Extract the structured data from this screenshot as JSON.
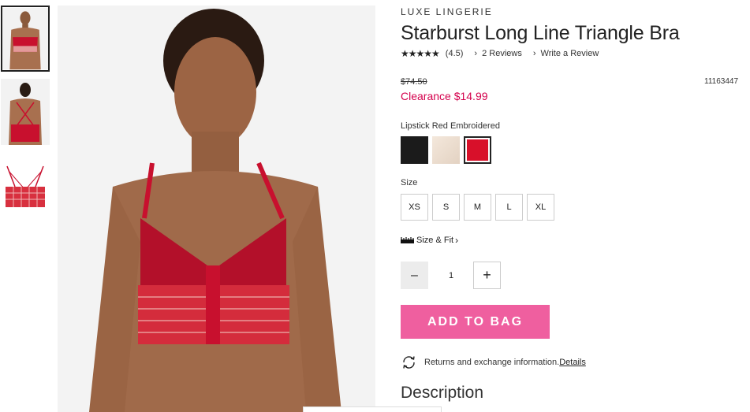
{
  "product": {
    "brand": "LUXE LINGERIE",
    "title": "Starburst Long Line Triangle Bra",
    "stars": "★★★★★",
    "rating": "(4.5)",
    "reviews_link": "2 Reviews",
    "write_review_link": "Write a Review",
    "original_price": "$74.50",
    "clearance_price": "Clearance $14.99",
    "sku": "11163447"
  },
  "color": {
    "label": "Lipstick Red Embroidered",
    "swatches": [
      {
        "color": "#1b1b1b"
      },
      {
        "color": "#eadccf"
      },
      {
        "color": "#d8102a",
        "selected": true
      }
    ]
  },
  "size": {
    "label": "Size",
    "options": [
      "XS",
      "S",
      "M",
      "L",
      "XL"
    ],
    "fit_link": "Size & Fit"
  },
  "quantity": {
    "minus": "–",
    "value": "1",
    "plus": "+"
  },
  "add_to_bag": "ADD TO BAG",
  "returns": {
    "text": "Returns and exchange information.",
    "link": "Details"
  },
  "description_title": "Description",
  "icons": {
    "chevron": "›",
    "ruler": "ruler-icon",
    "returns": "exchange-arrows-icon"
  },
  "colors": {
    "clearance": "#d4004c",
    "add_to_bag_bg": "#ef5f9f",
    "bra_red": "#c8102e"
  }
}
